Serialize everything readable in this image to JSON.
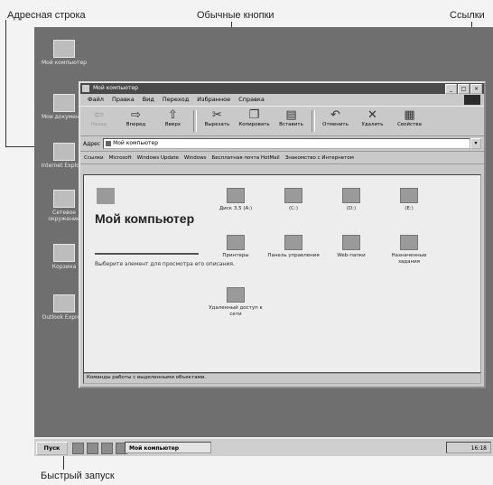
{
  "callouts": {
    "address_bar": "Адресная строка",
    "standard_buttons": "Обычные кнопки",
    "links": "Ссылки",
    "quick_launch": "Быстрый запуск"
  },
  "desktop_icons": [
    {
      "label": "Мой компьютер",
      "icon": "my-computer-icon"
    },
    {
      "label": "Мои документы",
      "icon": "my-documents-icon"
    },
    {
      "label": "Internet Explorer",
      "icon": "internet-explorer-icon"
    },
    {
      "label": "Сетевое окружение",
      "icon": "network-icon"
    },
    {
      "label": "Корзина",
      "icon": "recycle-bin-icon"
    },
    {
      "label": "Outlook Express",
      "icon": "outlook-express-icon"
    }
  ],
  "window": {
    "title": "Мой компьютер",
    "controls": [
      "_",
      "□",
      "×"
    ],
    "menu": [
      "Файл",
      "Правка",
      "Вид",
      "Переход",
      "Избранное",
      "Справка"
    ],
    "toolbar": [
      {
        "label": "Назад",
        "icon": "back-arrow-icon",
        "disabled": true
      },
      {
        "label": "Вперед",
        "icon": "forward-arrow-icon",
        "disabled": false
      },
      {
        "label": "Вверх",
        "icon": "up-folder-icon",
        "disabled": false
      },
      {
        "label": "Вырезать",
        "icon": "cut-icon",
        "disabled": false
      },
      {
        "label": "Копировать",
        "icon": "copy-icon",
        "disabled": false
      },
      {
        "label": "Вставить",
        "icon": "paste-icon",
        "disabled": false
      },
      {
        "label": "Отменить",
        "icon": "undo-icon",
        "disabled": false
      },
      {
        "label": "Удалить",
        "icon": "delete-icon",
        "disabled": false
      },
      {
        "label": "Свойства",
        "icon": "properties-icon",
        "disabled": false
      }
    ],
    "address": {
      "label": "Адрес",
      "value": "Мой компьютер"
    },
    "links": [
      "Ссылки",
      "Microsoft",
      "Windows Update",
      "Windows",
      "Бесплатная почта HotMail",
      "Знакомство с Интернетом"
    ],
    "content": {
      "title": "Мой компьютер",
      "hint": "Выберите элемент для просмотра его описания.",
      "items": [
        {
          "label": "Диск 3,5 (A:)",
          "icon": "floppy-drive-icon"
        },
        {
          "label": "(C:)",
          "icon": "hard-drive-icon"
        },
        {
          "label": "(D:)",
          "icon": "hard-drive-icon"
        },
        {
          "label": "(E:)",
          "icon": "cd-drive-icon"
        },
        {
          "label": "Принтеры",
          "icon": "printers-folder-icon"
        },
        {
          "label": "Панель управления",
          "icon": "control-panel-icon"
        },
        {
          "label": "Web-папки",
          "icon": "web-folders-icon"
        },
        {
          "label": "Назначенные задания",
          "icon": "scheduled-tasks-icon"
        },
        {
          "label": "Удаленный доступ к сети",
          "icon": "dialup-networking-icon"
        }
      ]
    },
    "status": "Команды работы с выделенными объектами."
  },
  "taskbar": {
    "start": "Пуск",
    "task": "Мой компьютер",
    "clock": "16:18"
  }
}
